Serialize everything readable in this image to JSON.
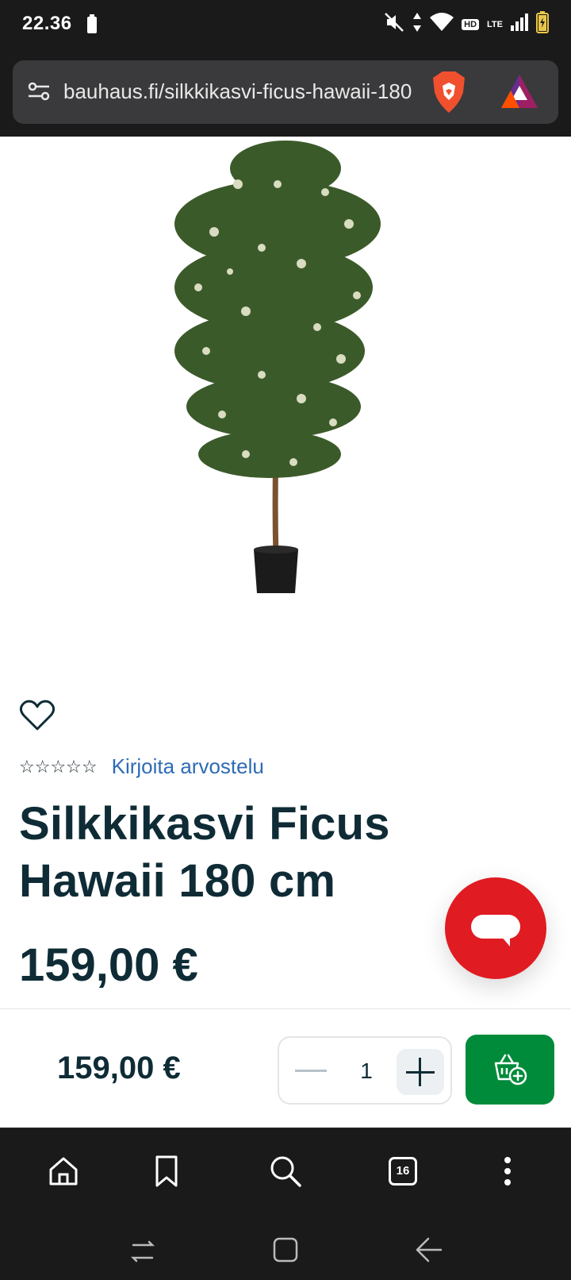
{
  "status_bar": {
    "time": "22.36",
    "network": "LTE",
    "hd_badge": "HD"
  },
  "browser": {
    "url": "bauhaus.fi/silkkikasvi-ficus-hawaii-180",
    "icons": [
      "site-settings-icon",
      "brave-shields-icon",
      "bat-rewards-icon"
    ]
  },
  "product": {
    "review_link": "Kirjoita arvostelu",
    "stars": "☆☆☆☆☆",
    "title": "Silkkikasvi Ficus Hawaii 180 cm",
    "price": "159,00 €"
  },
  "cart_bar": {
    "price": "159,00 €",
    "quantity": "1"
  },
  "nav": {
    "tab_count": "16"
  },
  "colors": {
    "accent_green": "#008b3a",
    "chat_red": "#e01b22",
    "text_dark": "#0f2c36",
    "link_blue": "#2d6bb5"
  }
}
